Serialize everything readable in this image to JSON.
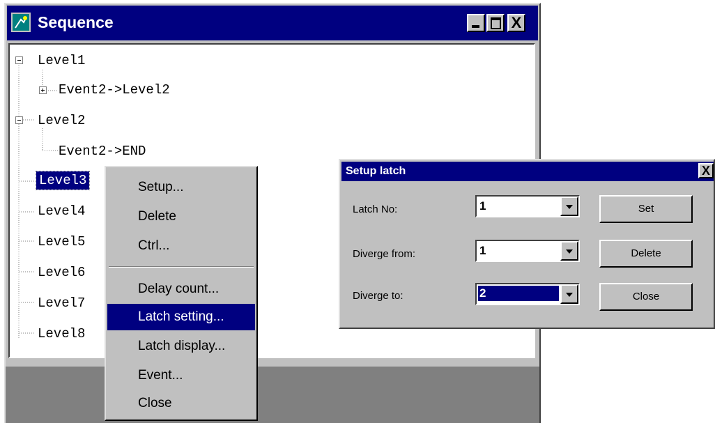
{
  "window": {
    "title": "Sequence",
    "icon": "sequence-app-icon",
    "controls": {
      "minimize": "_",
      "maximize": "□",
      "close": "X"
    }
  },
  "tree": {
    "nodes": [
      {
        "label": "Level1",
        "state": "expanded"
      },
      {
        "label": "Event2->Level2",
        "state": "collapsed"
      },
      {
        "label": "Level2",
        "state": "expanded"
      },
      {
        "label": "Event2->END",
        "state": "leaf"
      },
      {
        "label": "Level3",
        "state": "selected"
      },
      {
        "label": "Level4"
      },
      {
        "label": "Level5"
      },
      {
        "label": "Level6"
      },
      {
        "label": "Level7"
      },
      {
        "label": "Level8"
      }
    ]
  },
  "context_menu": {
    "items": [
      "Setup...",
      "Delete",
      "Ctrl...",
      "Delay count...",
      "Latch setting...",
      "Latch display...",
      "Event...",
      "Close"
    ],
    "active": "Latch setting..."
  },
  "dialog": {
    "title": "Setup latch",
    "close": "X",
    "fields": [
      {
        "label": "Latch No:",
        "value": "1"
      },
      {
        "label": "Diverge from:",
        "value": "1"
      },
      {
        "label": "Diverge to:",
        "value": "2"
      }
    ],
    "buttons": {
      "set": "Set",
      "delete": "Delete",
      "close": "Close"
    }
  },
  "colors": {
    "title_bar": "#000080",
    "face": "#c0c0c0",
    "selection": "#000080",
    "status_area": "#808080"
  }
}
